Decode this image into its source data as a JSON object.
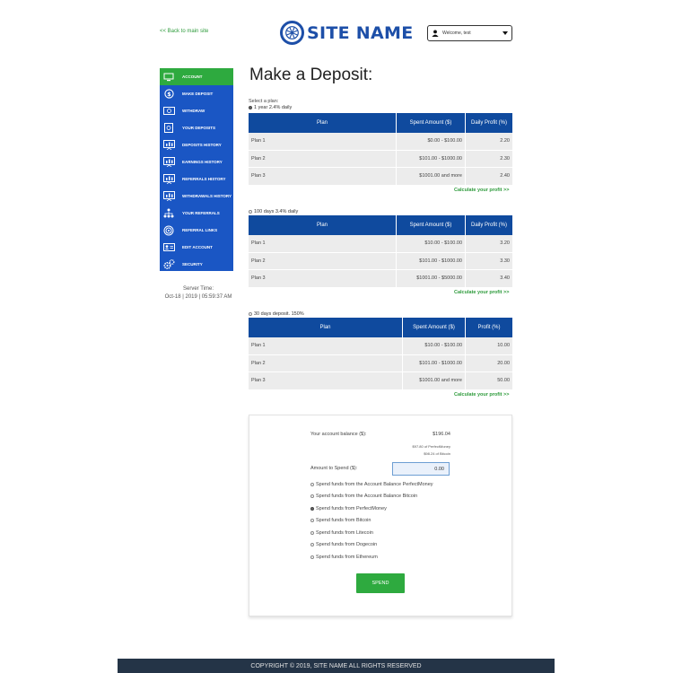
{
  "header": {
    "back_link": "<<  Back to main site",
    "logo_text": "SITE NAME",
    "user_dropdown": "Welcome, test"
  },
  "sidebar": {
    "items": [
      {
        "label": "Account",
        "icon": "monitor-icon",
        "active": true
      },
      {
        "label": "Make Deposit",
        "icon": "dollar-icon"
      },
      {
        "label": "Withdraw",
        "icon": "cash-icon"
      },
      {
        "label": "Your Deposits",
        "icon": "safe-icon"
      },
      {
        "label": "Deposits History",
        "icon": "chart-board-icon"
      },
      {
        "label": "Earnings History",
        "icon": "chart-board-icon"
      },
      {
        "label": "Referrals History",
        "icon": "chart-board-icon"
      },
      {
        "label": "Withdrawals History",
        "icon": "chart-board-icon"
      },
      {
        "label": "Your Referrals",
        "icon": "people-tree-icon"
      },
      {
        "label": "Referral Links",
        "icon": "target-icon"
      },
      {
        "label": "Edit Account",
        "icon": "id-card-icon"
      },
      {
        "label": "Security",
        "icon": "gears-icon"
      }
    ],
    "server_time_label": "Server Time:",
    "server_time_value": "Oct-18 | 2019 | 05:59:37 AM"
  },
  "main": {
    "title": "Make a Deposit:",
    "select_label": "Select a plan:",
    "plans": [
      {
        "radio_label": "1 year 2.4% daily",
        "selected": true,
        "headers": [
          "Plan",
          "Spent Amount ($)",
          "Daily Profit (%)"
        ],
        "rows": [
          [
            "Plan 1",
            "$0.00 - $100.00",
            "2.20"
          ],
          [
            "Plan 2",
            "$101.00 - $1000.00",
            "2.30"
          ],
          [
            "Plan 3",
            "$1001.00 and more",
            "2.40"
          ]
        ],
        "calc_link": "Calculate your profit >>"
      },
      {
        "radio_label": "100 days 3.4% daily",
        "selected": false,
        "headers": [
          "Plan",
          "Spent Amount ($)",
          "Daily Profit (%)"
        ],
        "rows": [
          [
            "Plan 1",
            "$10.00 - $100.00",
            "3.20"
          ],
          [
            "Plan 2",
            "$101.00 - $1000.00",
            "3.30"
          ],
          [
            "Plan 3",
            "$1001.00 - $5000.00",
            "3.40"
          ]
        ],
        "calc_link": "Calculate your profit >>"
      },
      {
        "radio_label": "30 days deposit. 150%",
        "selected": false,
        "headers": [
          "Plan",
          "Spent Amount ($)",
          "Profit (%)"
        ],
        "rows": [
          [
            "Plan 1",
            "$10.00 - $100.00",
            "10.00"
          ],
          [
            "Plan 2",
            "$101.00 - $1000.00",
            "20.00"
          ],
          [
            "Plan 3",
            "$1001.00 and more",
            "50.00"
          ]
        ],
        "calc_link": "Calculate your profit >>"
      }
    ]
  },
  "deposit_form": {
    "balance_label": "Your account balance ($):",
    "balance_value": "$196.04",
    "balance_perfectmoney": "$97.80 of PerfectMoney",
    "balance_bitcoin": "$98.24 of Bitcoin",
    "amount_label": "Amount to Spend ($):",
    "amount_value": "0.00",
    "options": [
      {
        "label": "Spend funds from the Account Balance PerfectMoney",
        "selected": false
      },
      {
        "label": "Spend funds from the Account Balance Bitcoin",
        "selected": false
      },
      {
        "label": "Spend funds from PerfectMoney",
        "selected": true
      },
      {
        "label": "Spend funds from Bitcoin",
        "selected": false
      },
      {
        "label": "Spend funds from Litecoin",
        "selected": false
      },
      {
        "label": "Spend funds from Dogecoin",
        "selected": false
      },
      {
        "label": "Spend funds from Ethereum",
        "selected": false
      }
    ],
    "spend_button": "SPEND"
  },
  "footer": {
    "copyright": "COPYRIGHT © 2019, SITE NAME ALL RIGHTS RESERVED"
  },
  "colors": {
    "primary_blue": "#1a56c4",
    "table_header_blue": "#0f4a9e",
    "accent_green": "#2eaa3f",
    "footer_bg": "#243447"
  }
}
